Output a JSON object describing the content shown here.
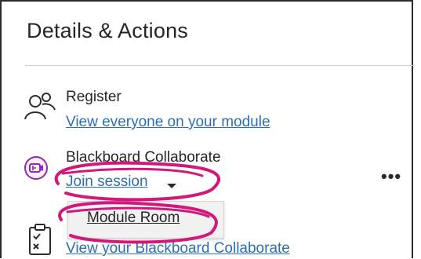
{
  "panel": {
    "title": "Details & Actions"
  },
  "register": {
    "icon": "users-icon",
    "title": "Register",
    "link": "View everyone on your module"
  },
  "collaborate": {
    "icon": "video-conference-icon",
    "title": "Blackboard Collaborate",
    "join_link": "Join session",
    "more_label": "•••",
    "dropdown_items": [
      "Module Room"
    ],
    "view_link": "View your Blackboard Collaborate"
  },
  "third": {
    "icon": "clipboard-icon"
  },
  "colors": {
    "link": "#2a6fb3",
    "annotation": "#d0197a",
    "collab_icon": "#8e2bb5"
  }
}
